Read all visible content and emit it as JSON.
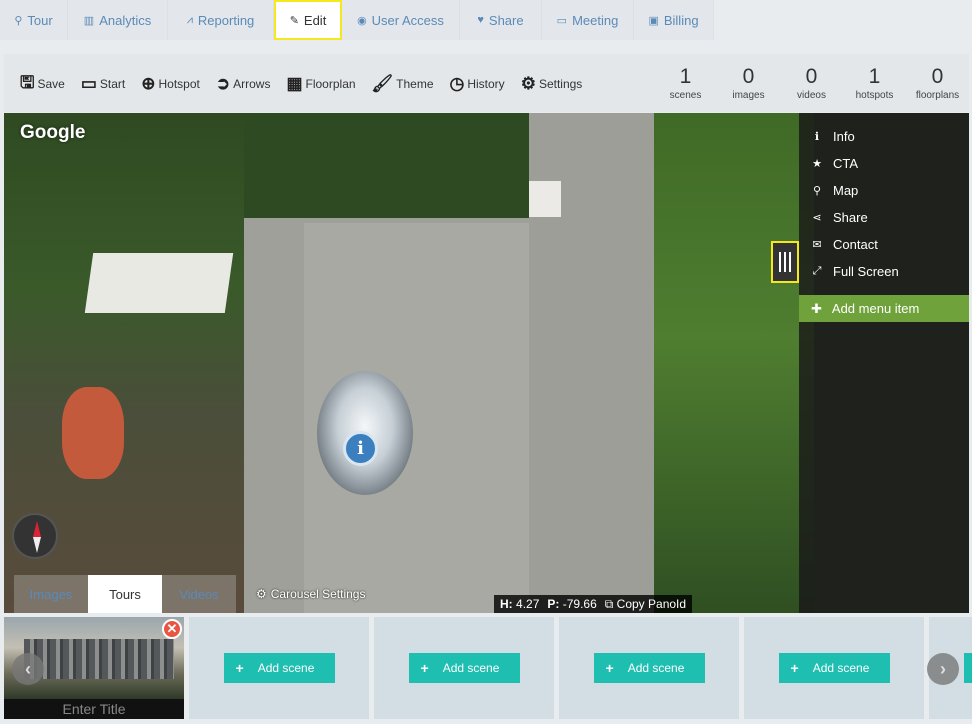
{
  "tabs": [
    {
      "icon": "map-marker-icon",
      "glyph": "⚲",
      "label": "Tour"
    },
    {
      "icon": "bar-chart-icon",
      "glyph": "▥",
      "label": "Analytics"
    },
    {
      "icon": "line-chart-icon",
      "glyph": "⩘",
      "label": "Reporting"
    },
    {
      "icon": "pencil-icon",
      "glyph": "✎",
      "label": "Edit"
    },
    {
      "icon": "users-icon",
      "glyph": "👥",
      "label": "User Access"
    },
    {
      "icon": "heart-icon",
      "glyph": "♥",
      "label": "Share"
    },
    {
      "icon": "monitor-icon",
      "glyph": "▭",
      "label": "Meeting"
    },
    {
      "icon": "lock-icon",
      "glyph": "🔒",
      "label": "Billing"
    }
  ],
  "active_tab": "Edit",
  "toolbar": {
    "save": "Save",
    "start": "Start",
    "hotspot": "Hotspot",
    "arrows": "Arrows",
    "floorplan": "Floorplan",
    "theme": "Theme",
    "history": "History",
    "settings": "Settings"
  },
  "stats": [
    {
      "value": "1",
      "label": "scenes"
    },
    {
      "value": "0",
      "label": "images"
    },
    {
      "value": "0",
      "label": "videos"
    },
    {
      "value": "1",
      "label": "hotspots"
    },
    {
      "value": "0",
      "label": "floorplans"
    }
  ],
  "viewer": {
    "google_label": "Google",
    "bottom_tabs": [
      "Images",
      "Tours",
      "Videos"
    ],
    "active_bottom_tab": "Tours",
    "carousel_settings": "Carousel Settings",
    "h_label": "H:",
    "h_value": "4.27",
    "p_label": "P:",
    "p_value": "-79.66",
    "copy_panoid": "Copy PanoId"
  },
  "side_menu": {
    "items": [
      {
        "icon": "info-icon",
        "label": "Info"
      },
      {
        "icon": "star-icon",
        "label": "CTA"
      },
      {
        "icon": "map-pin-icon",
        "label": "Map"
      },
      {
        "icon": "share-icon",
        "label": "Share"
      },
      {
        "icon": "envelope-icon",
        "label": "Contact"
      },
      {
        "icon": "fullscreen-icon",
        "label": "Full Screen"
      }
    ],
    "add_item": "Add menu item"
  },
  "scene_strip": {
    "scene_title_placeholder": "Enter Title",
    "add_scene_label": "Add scene"
  },
  "colors": {
    "accent_green": "#6fa23a",
    "add_scene_teal": "#1ebfb0",
    "highlight_yellow": "#f5e81f",
    "tab_blue": "#5b8ab8"
  }
}
